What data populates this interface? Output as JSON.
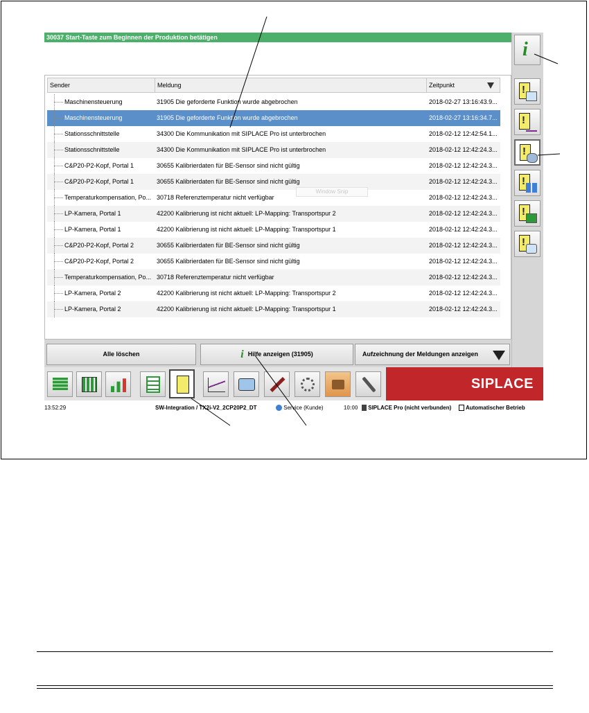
{
  "banner": {
    "text": "30037 Start-Taste zum Beginnen der Produktion betätigen"
  },
  "table": {
    "headers": {
      "sender": "Sender",
      "message": "Meldung",
      "time": "Zeitpunkt"
    },
    "rows": [
      {
        "sender": "Maschinensteuerung",
        "message": "31905 Die geforderte Funktion wurde abgebrochen",
        "time": "2018-02-27 13:16:43.9...",
        "selected": false
      },
      {
        "sender": "Maschinensteuerung",
        "message": "31905 Die geforderte Funktion wurde abgebrochen",
        "time": "2018-02-27 13:16:34.7...",
        "selected": true
      },
      {
        "sender": "Stationsschnittstelle",
        "message": "34300 Die Kommunikation mit SIPLACE Pro ist unterbrochen",
        "time": "2018-02-12 12:42:54.1...",
        "selected": false
      },
      {
        "sender": "Stationsschnittstelle",
        "message": "34300 Die Kommunikation mit SIPLACE Pro ist unterbrochen",
        "time": "2018-02-12 12:42:24.3...",
        "selected": false
      },
      {
        "sender": "C&P20-P2-Kopf, Portal 1",
        "message": "30655 Kalibrierdaten für BE-Sensor sind nicht gültig",
        "time": "2018-02-12 12:42:24.3...",
        "selected": false
      },
      {
        "sender": "C&P20-P2-Kopf, Portal 1",
        "message": "30655 Kalibrierdaten für BE-Sensor sind nicht gültig",
        "time": "2018-02-12 12:42:24.3...",
        "selected": false
      },
      {
        "sender": "Temperaturkompensation, Po...",
        "message": "30718 Referenztemperatur nicht verfügbar",
        "time": "2018-02-12 12:42:24.3...",
        "selected": false
      },
      {
        "sender": "LP-Kamera, Portal 1",
        "message": "42200 Kalibrierung ist nicht aktuell: LP-Mapping: Transportspur 2",
        "time": "2018-02-12 12:42:24.3...",
        "selected": false
      },
      {
        "sender": "LP-Kamera, Portal 1",
        "message": "42200 Kalibrierung ist nicht aktuell: LP-Mapping: Transportspur 1",
        "time": "2018-02-12 12:42:24.3...",
        "selected": false
      },
      {
        "sender": "C&P20-P2-Kopf, Portal 2",
        "message": "30655 Kalibrierdaten für BE-Sensor sind nicht gültig",
        "time": "2018-02-12 12:42:24.3...",
        "selected": false
      },
      {
        "sender": "C&P20-P2-Kopf, Portal 2",
        "message": "30655 Kalibrierdaten für BE-Sensor sind nicht gültig",
        "time": "2018-02-12 12:42:24.3...",
        "selected": false
      },
      {
        "sender": "Temperaturkompensation, Po...",
        "message": "30718 Referenztemperatur nicht verfügbar",
        "time": "2018-02-12 12:42:24.3...",
        "selected": false
      },
      {
        "sender": "LP-Kamera, Portal 2",
        "message": "42200 Kalibrierung ist nicht aktuell: LP-Mapping: Transportspur 2",
        "time": "2018-02-12 12:42:24.3...",
        "selected": false
      },
      {
        "sender": "LP-Kamera, Portal 2",
        "message": "42200 Kalibrierung ist nicht aktuell: LP-Mapping: Transportspur 1",
        "time": "2018-02-12 12:42:24.3...",
        "selected": false
      }
    ]
  },
  "overlay": {
    "window_snip": "Window Snip"
  },
  "buttons": {
    "clear_all": "Alle löschen",
    "show_help": "Hilfe anzeigen (31905)",
    "show_log": "Aufzeichnung der Meldungen anzeigen"
  },
  "sidebar": {
    "icons": [
      "info-icon",
      "message-monitor-icon",
      "message-chart-icon",
      "message-operator-icon",
      "message-bars-icon",
      "message-feeder-icon",
      "message-camera-icon"
    ],
    "active_index": 3
  },
  "toolbar": {
    "icons": [
      "stack-icon",
      "grid-icon",
      "bar-chart-icon",
      "layout-icon",
      "messages-icon",
      "line-chart-icon",
      "camera-icon",
      "tool-icon",
      "hand-gear-icon",
      "oil-can-icon",
      "wrench-icon"
    ],
    "active_index": 4,
    "brand": "SIPLACE",
    "brand_color": "#c1262b"
  },
  "status": {
    "time": "13:52:29",
    "program": "SW-Integration / TX2i-V2_2CP20P2_DT",
    "user": "Service (Kunde)",
    "user_time": "10:00",
    "connection": "SIPLACE Pro (nicht verbunden)",
    "mode": "Automatischer Betrieb"
  },
  "colors": {
    "banner": "#4caf6a",
    "selection": "#5b8fc9",
    "info_green": "#2a8a2a"
  }
}
